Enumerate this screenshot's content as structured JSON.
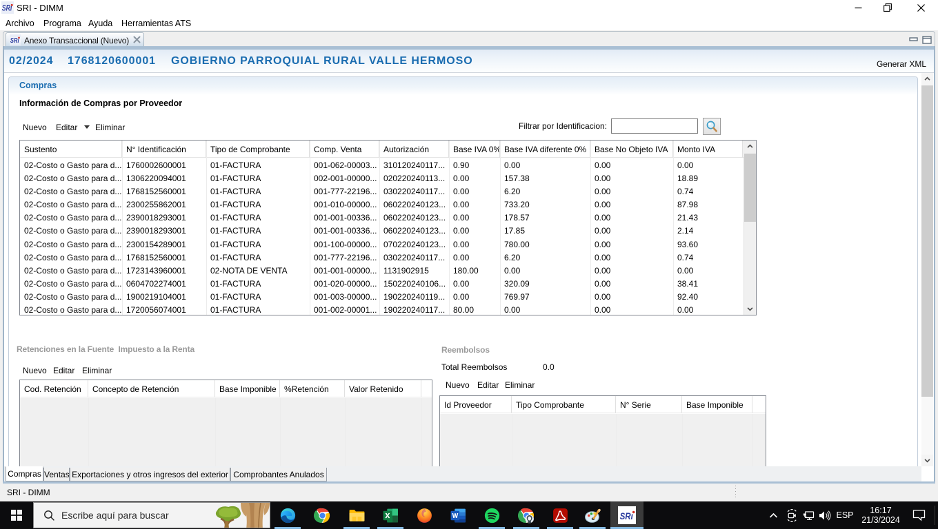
{
  "window": {
    "title": "SRI - DIMM",
    "icon": "sri-logo",
    "controls": [
      "minimize",
      "restore",
      "close"
    ]
  },
  "menu": {
    "items": [
      "Archivo",
      "Programa",
      "Ayuda",
      "Herramientas ATS"
    ]
  },
  "editor_tab": {
    "icon": "sri-logo",
    "label": "Anexo Transaccional (Nuevo)",
    "close_icon": "close-x"
  },
  "view_header": {
    "period": "02/2024",
    "ruc": "1768120600001",
    "taxpayer": "GOBIERNO PARROQUIAL RURAL VALLE HERMOSO",
    "action": "Generar XML",
    "accent_color": "#1a6cb0"
  },
  "compras": {
    "group_label": "Compras",
    "section_title": "Información de Compras por Proveedor",
    "toolbar": {
      "nuevo": "Nuevo",
      "editar": "Editar",
      "eliminar": "Eliminar"
    },
    "filter": {
      "label": "Filtrar por Identificacion:",
      "value": "",
      "button_icon": "magnifier-icon"
    },
    "table": {
      "columns": [
        "Sustento",
        "N° Identificación",
        "Tipo de Comprobante",
        "Comp. Venta",
        "Autorización",
        "Base IVA 0%",
        "Base IVA diferente 0%",
        "Base No Objeto IVA",
        "Monto IVA"
      ],
      "rows": [
        [
          "02-Costo o Gasto para d...",
          "1760002600001",
          "01-FACTURA",
          "001-062-00003...",
          "310120240117...",
          "0.90",
          "0.00",
          "0.00",
          "0.00"
        ],
        [
          "02-Costo o Gasto para d...",
          "1306220094001",
          "01-FACTURA",
          "002-001-00000...",
          "020220240113...",
          "0.00",
          "157.38",
          "0.00",
          "18.89"
        ],
        [
          "02-Costo o Gasto para d...",
          "1768152560001",
          "01-FACTURA",
          "001-777-22196...",
          "030220240117...",
          "0.00",
          "6.20",
          "0.00",
          "0.74"
        ],
        [
          "02-Costo o Gasto para d...",
          "2300255862001",
          "01-FACTURA",
          "001-010-00000...",
          "060220240123...",
          "0.00",
          "733.20",
          "0.00",
          "87.98"
        ],
        [
          "02-Costo o Gasto para d...",
          "2390018293001",
          "01-FACTURA",
          "001-001-00336...",
          "060220240123...",
          "0.00",
          "178.57",
          "0.00",
          "21.43"
        ],
        [
          "02-Costo o Gasto para d...",
          "2390018293001",
          "01-FACTURA",
          "001-001-00336...",
          "060220240123...",
          "0.00",
          "17.85",
          "0.00",
          "2.14"
        ],
        [
          "02-Costo o Gasto para d...",
          "2300154289001",
          "01-FACTURA",
          "001-100-00000...",
          "070220240123...",
          "0.00",
          "780.00",
          "0.00",
          "93.60"
        ],
        [
          "02-Costo o Gasto para d...",
          "1768152560001",
          "01-FACTURA",
          "001-777-22196...",
          "030220240117...",
          "0.00",
          "6.20",
          "0.00",
          "0.74"
        ],
        [
          "02-Costo o Gasto para d...",
          "1723143960001",
          "02-NOTA DE VENTA",
          "001-001-00000...",
          "1131902915",
          "180.00",
          "0.00",
          "0.00",
          "0.00"
        ],
        [
          "02-Costo o Gasto para d...",
          "0604702274001",
          "01-FACTURA",
          "001-020-00000...",
          "150220240106...",
          "0.00",
          "320.09",
          "0.00",
          "38.41"
        ],
        [
          "02-Costo o Gasto para d...",
          "1900219104001",
          "01-FACTURA",
          "001-003-00000...",
          "190220240119...",
          "0.00",
          "769.97",
          "0.00",
          "92.40"
        ],
        [
          "02-Costo o Gasto para d...",
          "1720056074001",
          "01-FACTURA",
          "001-002-00001...",
          "190220240117...",
          "80.00",
          "0.00",
          "0.00",
          "0.00"
        ]
      ]
    }
  },
  "retenciones": {
    "title": "Retenciones en la Fuente  Impuesto a la Renta",
    "toolbar": {
      "nuevo": "Nuevo",
      "editar": "Editar",
      "eliminar": "Eliminar"
    },
    "columns": [
      "Cod. Retención",
      "Concepto de Retención",
      "Base Imponible",
      "%Retención",
      "Valor Retenido"
    ],
    "rows": []
  },
  "reembolsos": {
    "title": "Reembolsos",
    "total_label": "Total Reembolsos",
    "total_value": "0.0",
    "toolbar": {
      "nuevo": "Nuevo",
      "editar": "Editar",
      "eliminar": "Eliminar"
    },
    "columns": [
      "Id Proveedor",
      "Tipo Comprobante",
      "N° Serie",
      "Base Imponible"
    ],
    "rows": []
  },
  "bottom_tabs": {
    "items": [
      "Compras",
      "Ventas",
      "Exportaciones y otros ingresos del exterior",
      "Comprobantes Anulados"
    ],
    "selected": "Compras"
  },
  "statusbar": {
    "text": "SRI - DIMM"
  },
  "taskbar": {
    "start_icon": "windows-logo",
    "search": {
      "placeholder": "Escribe aquí para buscar",
      "icon": "search-magnifier-icon",
      "art": "tree-illustration"
    },
    "app_icons": [
      "edge",
      "chrome",
      "file-explorer",
      "excel",
      "firefox",
      "word",
      "spotify",
      "chrome-profile",
      "acrobat",
      "paint",
      "sri-dimm"
    ],
    "running_apps": [
      "edge",
      "file-explorer",
      "excel",
      "spotify",
      "chrome-profile",
      "acrobat",
      "paint",
      "sri-dimm"
    ],
    "active_app": "sri-dimm",
    "tray": {
      "chevron_icon": "chevron-up-icon",
      "icons": [
        "meet-now-camera-icon",
        "network-icon",
        "volume-icon"
      ],
      "language": "ESP",
      "time": "16:17",
      "date": "21/3/2024",
      "notification_icon": "notification-bubble-icon"
    },
    "underline_color": "#85b9e2"
  }
}
